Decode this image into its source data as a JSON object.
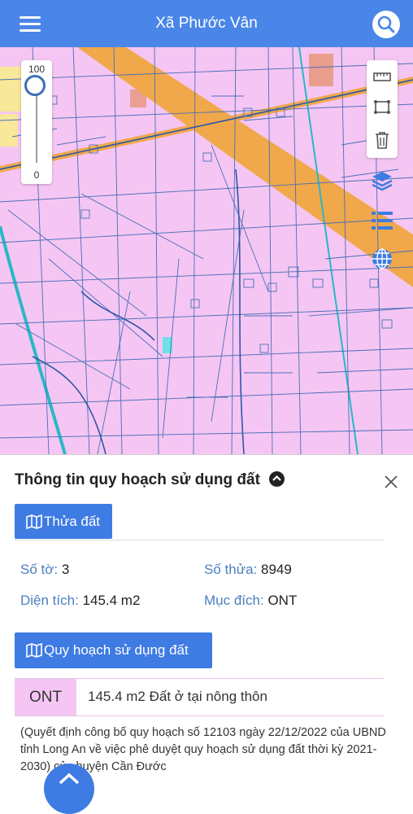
{
  "header": {
    "title": "Xã Phước Vân"
  },
  "slider": {
    "max_label": "100",
    "min_label": "0"
  },
  "panel": {
    "title": "Thông tin quy hoạch sử dụng đất",
    "parcel_button": "Thửa đất",
    "fields": {
      "so_to_label": "Số tờ:",
      "so_to_value": "3",
      "so_thua_label": "Số thửa:",
      "so_thua_value": "8949",
      "dien_tich_label": "Diện tích:",
      "dien_tich_value": "145.4 m2",
      "muc_dich_label": "Mục đích:",
      "muc_dich_value": "ONT"
    },
    "planning_button": "Quy hoạch sử dụng đất",
    "land_use": {
      "code": "ONT",
      "description": "145.4 m2 Đất ở tại nông thôn"
    },
    "note": "(Quyết định công bố quy hoạch số 12103 ngày 22/12/2022 của UBND tỉnh Long An về việc phê duyệt quy hoạch sử dụng đất thời kỳ 2021-2030) của huyện Cần Đước"
  },
  "colors": {
    "header": "#4a86e8",
    "land_residential": "#f5c6f3",
    "planned_road": "#f0a84a",
    "parcel_line": "#4a6fb8",
    "button": "#3e7be3"
  },
  "icons": [
    "menu-icon",
    "search-icon",
    "ruler-icon",
    "area-measure-icon",
    "trash-icon",
    "layers-icon",
    "list-icon",
    "globe-icon",
    "map-icon",
    "chevron-up-icon",
    "close-icon"
  ]
}
